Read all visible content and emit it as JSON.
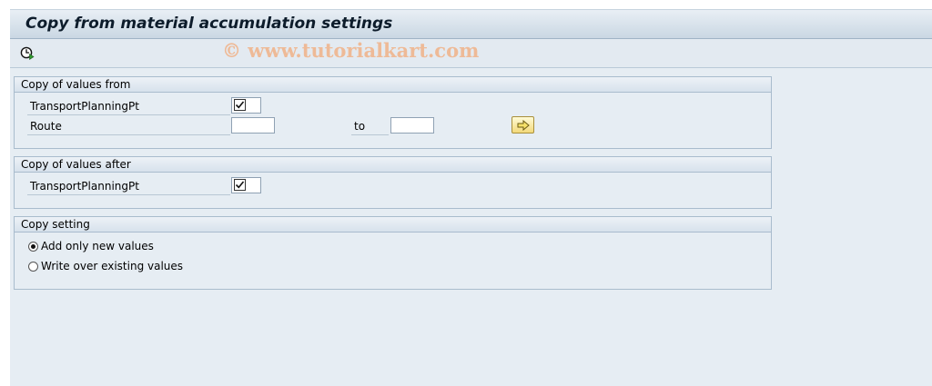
{
  "title": "Copy from material accumulation settings",
  "watermark": "© www.tutorialkart.com",
  "toolbar": {
    "execute_icon": "execute-clock-icon"
  },
  "group_from": {
    "header": "Copy of values from",
    "transport_label": "TransportPlanningPt",
    "transport_checked": true,
    "route_label": "Route",
    "route_value": "",
    "to_label": "to",
    "to_value": "",
    "nav_icon": "arrow-right-icon"
  },
  "group_after": {
    "header": "Copy of values after",
    "transport_label": "TransportPlanningPt",
    "transport_checked": true
  },
  "group_setting": {
    "header": "Copy setting",
    "options": [
      {
        "label": "Add only new values",
        "selected": true
      },
      {
        "label": "Write over existing values",
        "selected": false
      }
    ]
  }
}
